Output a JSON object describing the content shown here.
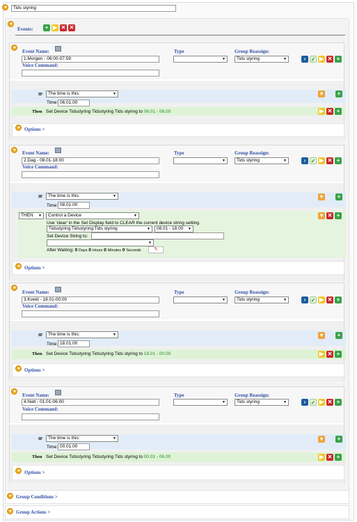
{
  "group_name": "Tids styring",
  "events_label": "Events:",
  "type_label": "Type",
  "group_reassign_label": "Group Reassign:",
  "event_name_label": "Event Name:",
  "voice_command_label": "Voice Command:",
  "options_label": "Options >",
  "if_label": "IF",
  "then_label": "Then",
  "time_label": "Time:",
  "condition_select": "The time is this:",
  "reassign_value": "Tids styring",
  "group_conditions": "Group Conditions >",
  "group_actions": "Group Actions >",
  "events": [
    {
      "name": "1.Morgen - 06:00-07:59",
      "time": "06.01.00",
      "then_prefix": "Set Device Tidsstyring Tidsstyring Tids styring to ",
      "then_value": "06.01 - 08.00"
    },
    {
      "name": "2.Dag - 08.01-18:00",
      "time": "08.01.00",
      "then_select": "THEN",
      "action_select": "Control a Device",
      "hint": "Use 'clear' in the Set Display field to CLEAR the current device string setting.",
      "device_select": "Tidsstyring Tidsstyring Tids styring",
      "value_select": "08.01 - 18.00",
      "set_string_label": "Set Device String to:",
      "after_waiting": "After Waiting:",
      "days_n": "0",
      "days_l": "Days",
      "hours_n": "0",
      "hours_l": "Hours",
      "minutes_n": "0",
      "minutes_l": "Minutes",
      "seconds_n": "0",
      "seconds_l": "Seconds"
    },
    {
      "name": "3.Kveld - 18.01-00:00",
      "time": "18.01.00",
      "then_prefix": "Set Device Tidsstyring Tidsstyring Tids styring to ",
      "then_value": "18.01 - 00.00"
    },
    {
      "name": "4.Natt - 01:01-06:00",
      "time": "00.01.00",
      "then_prefix": "Set Device Tidsstyring Tidsstyring Tids styring to ",
      "then_value": "00.01 - 06.00"
    }
  ]
}
